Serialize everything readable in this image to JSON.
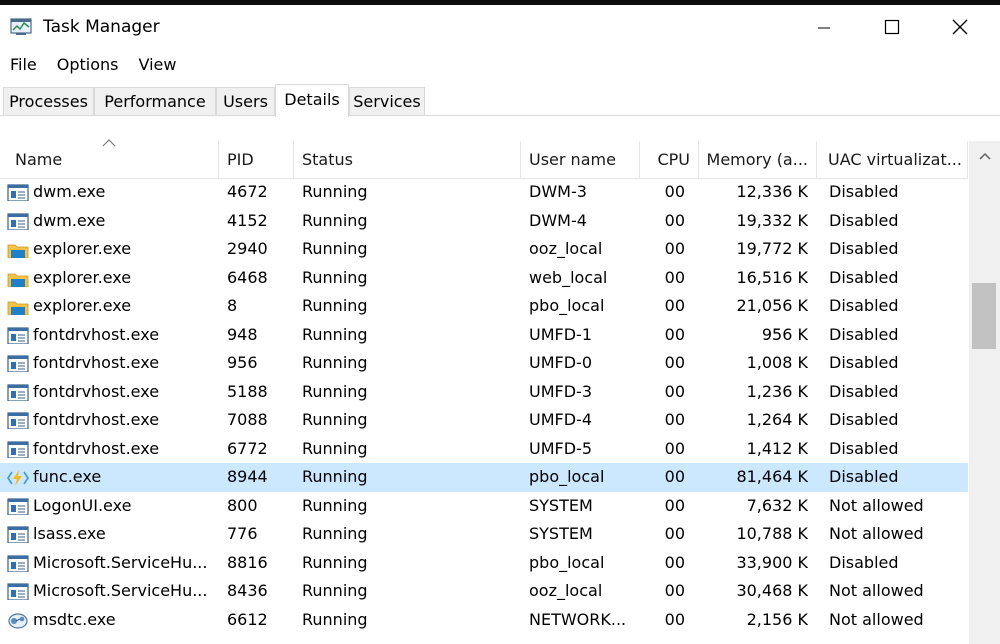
{
  "window": {
    "title": "Task Manager"
  },
  "menu": [
    "File",
    "Options",
    "View"
  ],
  "tabs": [
    {
      "label": "Processes",
      "active": false
    },
    {
      "label": "Performance",
      "active": false
    },
    {
      "label": "Users",
      "active": false
    },
    {
      "label": "Details",
      "active": true
    },
    {
      "label": "Services",
      "active": false
    }
  ],
  "columns": {
    "name": "Name",
    "pid": "PID",
    "status": "Status",
    "user": "User name",
    "cpu": "CPU",
    "memory": "Memory (a...",
    "uac": "UAC virtualizat..."
  },
  "rows": [
    {
      "icon": "window-app-icon",
      "name": "dwm.exe",
      "pid": "4672",
      "status": "Running",
      "user": "DWM-3",
      "cpu": "00",
      "memory": "12,336 K",
      "uac": "Disabled"
    },
    {
      "icon": "window-app-icon",
      "name": "dwm.exe",
      "pid": "4152",
      "status": "Running",
      "user": "DWM-4",
      "cpu": "00",
      "memory": "19,332 K",
      "uac": "Disabled"
    },
    {
      "icon": "folder-icon",
      "name": "explorer.exe",
      "pid": "2940",
      "status": "Running",
      "user": "ooz_local",
      "cpu": "00",
      "memory": "19,772 K",
      "uac": "Disabled"
    },
    {
      "icon": "folder-icon",
      "name": "explorer.exe",
      "pid": "6468",
      "status": "Running",
      "user": "web_local",
      "cpu": "00",
      "memory": "16,516 K",
      "uac": "Disabled"
    },
    {
      "icon": "folder-icon",
      "name": "explorer.exe",
      "pid": "8",
      "status": "Running",
      "user": "pbo_local",
      "cpu": "00",
      "memory": "21,056 K",
      "uac": "Disabled"
    },
    {
      "icon": "window-app-icon",
      "name": "fontdrvhost.exe",
      "pid": "948",
      "status": "Running",
      "user": "UMFD-1",
      "cpu": "00",
      "memory": "956 K",
      "uac": "Disabled"
    },
    {
      "icon": "window-app-icon",
      "name": "fontdrvhost.exe",
      "pid": "956",
      "status": "Running",
      "user": "UMFD-0",
      "cpu": "00",
      "memory": "1,008 K",
      "uac": "Disabled"
    },
    {
      "icon": "window-app-icon",
      "name": "fontdrvhost.exe",
      "pid": "5188",
      "status": "Running",
      "user": "UMFD-3",
      "cpu": "00",
      "memory": "1,236 K",
      "uac": "Disabled"
    },
    {
      "icon": "window-app-icon",
      "name": "fontdrvhost.exe",
      "pid": "7088",
      "status": "Running",
      "user": "UMFD-4",
      "cpu": "00",
      "memory": "1,264 K",
      "uac": "Disabled"
    },
    {
      "icon": "window-app-icon",
      "name": "fontdrvhost.exe",
      "pid": "6772",
      "status": "Running",
      "user": "UMFD-5",
      "cpu": "00",
      "memory": "1,412 K",
      "uac": "Disabled"
    },
    {
      "icon": "azure-functions-icon",
      "name": "func.exe",
      "pid": "8944",
      "status": "Running",
      "user": "pbo_local",
      "cpu": "00",
      "memory": "81,464 K",
      "uac": "Disabled",
      "selected": true
    },
    {
      "icon": "window-app-icon",
      "name": "LogonUI.exe",
      "pid": "800",
      "status": "Running",
      "user": "SYSTEM",
      "cpu": "00",
      "memory": "7,632 K",
      "uac": "Not allowed"
    },
    {
      "icon": "window-app-icon",
      "name": "lsass.exe",
      "pid": "776",
      "status": "Running",
      "user": "SYSTEM",
      "cpu": "00",
      "memory": "10,788 K",
      "uac": "Not allowed"
    },
    {
      "icon": "window-app-icon",
      "name": "Microsoft.ServiceHu...",
      "pid": "8816",
      "status": "Running",
      "user": "pbo_local",
      "cpu": "00",
      "memory": "33,900 K",
      "uac": "Disabled"
    },
    {
      "icon": "window-app-icon",
      "name": "Microsoft.ServiceHu...",
      "pid": "8436",
      "status": "Running",
      "user": "ooz_local",
      "cpu": "00",
      "memory": "30,468 K",
      "uac": "Not allowed"
    },
    {
      "icon": "msdtc-icon",
      "name": "msdtc.exe",
      "pid": "6612",
      "status": "Running",
      "user": "NETWORK...",
      "cpu": "00",
      "memory": "2,156 K",
      "uac": "Not allowed"
    }
  ],
  "colors": {
    "selected_row": "#cce8ff",
    "grid_line": "#e5e5e5",
    "tab_bg": "#f0f0f0"
  }
}
